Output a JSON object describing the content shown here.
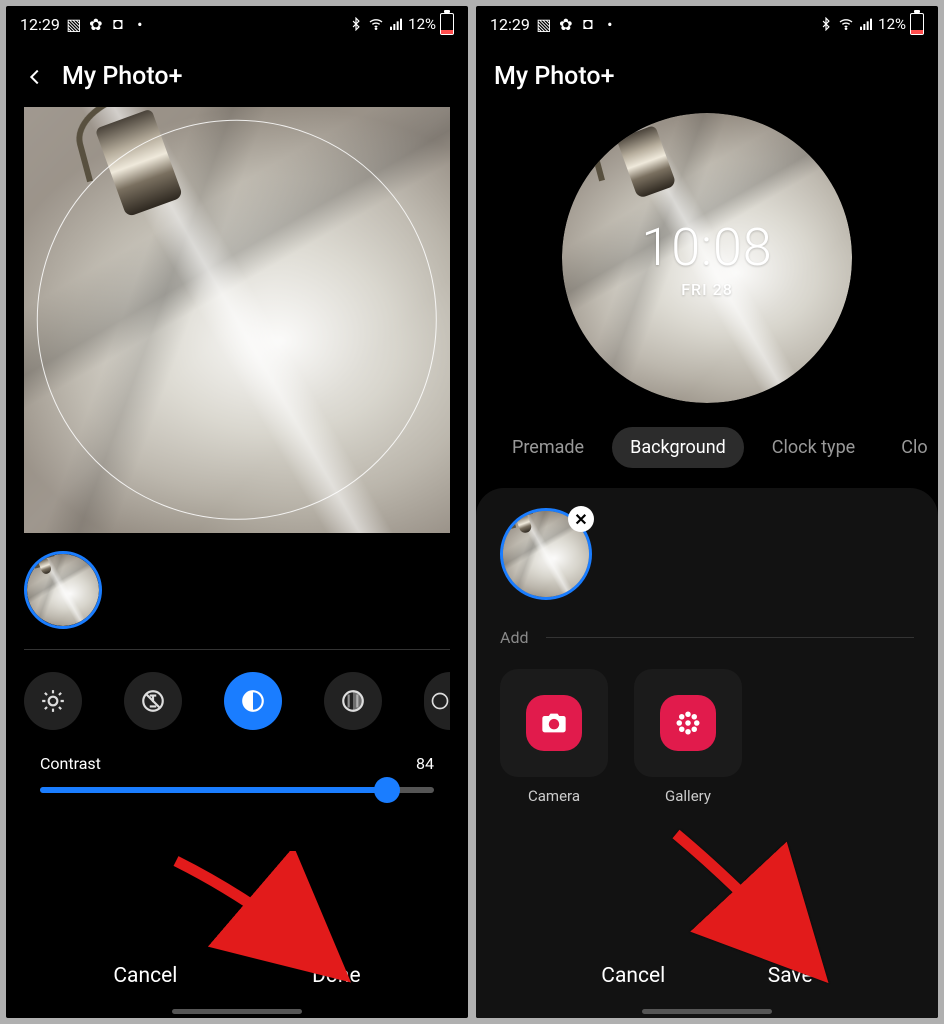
{
  "status": {
    "time": "12:29",
    "battery_pct": "12%"
  },
  "left": {
    "title": "My Photo+",
    "slider": {
      "label": "Contrast",
      "value": "84"
    },
    "footer": {
      "cancel": "Cancel",
      "done": "Done"
    }
  },
  "right": {
    "title": "My Photo+",
    "clock": {
      "time": "10:08",
      "date": "FRI 28"
    },
    "tabs": [
      "Premade",
      "Background",
      "Clock type",
      "Clo"
    ],
    "add_label": "Add",
    "sources": {
      "camera": "Camera",
      "gallery": "Gallery"
    },
    "footer": {
      "cancel": "Cancel",
      "save": "Save"
    }
  }
}
